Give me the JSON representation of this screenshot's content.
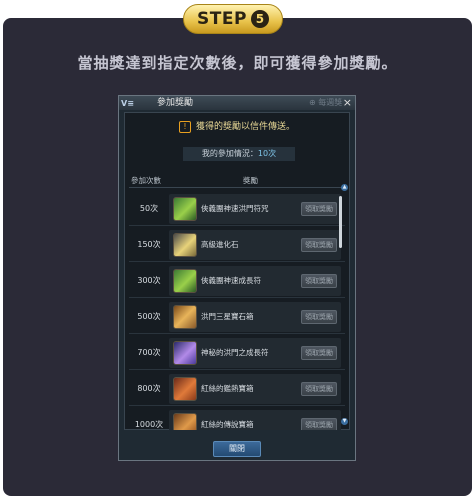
{
  "step": {
    "label": "STEP",
    "number": "5"
  },
  "instruction": "當抽獎達到指定次數後，即可獲得參加獎勵。",
  "dialog": {
    "logo": "V≡",
    "title": "參加獎勵",
    "ghost_text": "⊕ 每週獎",
    "close_icon": "×",
    "notice": "獲得的獎勵以信件傳送。",
    "warning_icon": "!",
    "participation_label": "我的參加情況：",
    "participation_value": "10次",
    "headers": {
      "count": "參加次數",
      "reward": "獎勵"
    },
    "claim_label": "領取獎勵",
    "close_button": "關閉",
    "rewards": [
      {
        "count": "50次",
        "name": "俠義團神速洪門符咒",
        "icon": "talisman-icon"
      },
      {
        "count": "150次",
        "name": "高級進化石",
        "icon": "evolution-stone-icon"
      },
      {
        "count": "300次",
        "name": "俠義團神速成長符",
        "icon": "growth-talisman-icon"
      },
      {
        "count": "500次",
        "name": "洪門三星寶石箱",
        "icon": "gem-box-icon"
      },
      {
        "count": "700次",
        "name": "神秘的洪門之成長符",
        "icon": "mystic-talisman-icon"
      },
      {
        "count": "800次",
        "name": "紅絲的鑑熱寶箱",
        "icon": "treasure-box-icon"
      },
      {
        "count": "1000次",
        "name": "紅絲的傳說寶箱",
        "icon": "legend-box-icon"
      }
    ]
  }
}
